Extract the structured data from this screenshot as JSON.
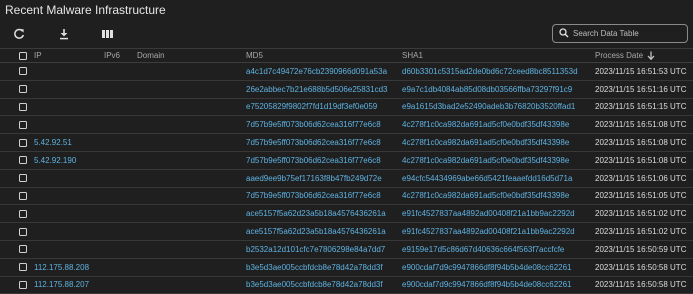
{
  "title": "Recent Malware Infrastructure",
  "toolbar": {
    "refresh_icon": "refresh-icon",
    "download_icon": "download-icon",
    "columns_icon": "columns-icon",
    "search_placeholder": "Search Data Table"
  },
  "columns": [
    "IP",
    "IPv6",
    "Domain",
    "MD5",
    "SHA1",
    "Process Date"
  ],
  "sort": {
    "column": "Process Date",
    "direction": "descending",
    "icon": "arrow-down-icon"
  },
  "colors": {
    "background": "#1f1f1f",
    "link": "#5fb3e3",
    "text": "#d6d6d6"
  },
  "rows": [
    {
      "ip": "",
      "ipv6": "",
      "domain": "",
      "md5": "a4c1d7c49472e76cb2390966d091a53a",
      "sha1": "d60b3301c5315ad2de0bd6c72ceed8bc8511353d",
      "date": "2023/11/15 16:51:53 UTC"
    },
    {
      "ip": "",
      "ipv6": "",
      "domain": "",
      "md5": "26e2abbec7b21e688b5d506e25831cd3",
      "sha1": "e9a7c1db4084ab85d08db03566ffba73297f91c9",
      "date": "2023/11/15 16:51:16 UTC"
    },
    {
      "ip": "",
      "ipv6": "",
      "domain": "",
      "md5": "e75205829f9802f7fd1d19df3ef0e059",
      "sha1": "e9a1615d3bad2e52490adeb3b76820b3520ffad1",
      "date": "2023/11/15 16:51:15 UTC"
    },
    {
      "ip": "",
      "ipv6": "",
      "domain": "",
      "md5": "7d57b9e5ff073b06d62cea316f77e6c8",
      "sha1": "4c278f1c0ca982da691ad5cf0e0bdf35df43398e",
      "date": "2023/11/15 16:51:08 UTC"
    },
    {
      "ip": "5.42.92.51",
      "ipv6": "",
      "domain": "",
      "md5": "7d57b9e5ff073b06d62cea316f77e6c8",
      "sha1": "4c278f1c0ca982da691ad5cf0e0bdf35df43398e",
      "date": "2023/11/15 16:51:08 UTC"
    },
    {
      "ip": "5.42.92.190",
      "ipv6": "",
      "domain": "",
      "md5": "7d57b9e5ff073b06d62cea316f77e6c8",
      "sha1": "4c278f1c0ca982da691ad5cf0e0bdf35df43398e",
      "date": "2023/11/15 16:51:08 UTC"
    },
    {
      "ip": "",
      "ipv6": "",
      "domain": "",
      "md5": "aaed9ee9b75ef17163f8b47fb249d72e",
      "sha1": "e94cfc54434969abe66d5421feaaefdd16d5d71a",
      "date": "2023/11/15 16:51:06 UTC"
    },
    {
      "ip": "",
      "ipv6": "",
      "domain": "",
      "md5": "7d57b9e5ff073b06d62cea316f77e6c8",
      "sha1": "4c278f1c0ca982da691ad5cf0e0bdf35df43398e",
      "date": "2023/11/15 16:51:05 UTC"
    },
    {
      "ip": "",
      "ipv6": "",
      "domain": "",
      "md5": "ace5157f5a62d23a5b18a4576436261a",
      "sha1": "e91fc4527837aa4892ad00408f21a1bb9ac2292d",
      "date": "2023/11/15 16:51:02 UTC"
    },
    {
      "ip": "",
      "ipv6": "",
      "domain": "",
      "md5": "ace5157f5a62d23a5b18a4576436261a",
      "sha1": "e91fc4527837aa4892ad00408f21a1bb9ac2292d",
      "date": "2023/11/15 16:51:02 UTC"
    },
    {
      "ip": "",
      "ipv6": "",
      "domain": "",
      "md5": "b2532a12d101cfc7e7806298e84a7dd7",
      "sha1": "e9159e17d5c86d67d40636c664f563f7accfcfe",
      "date": "2023/11/15 16:50:59 UTC"
    },
    {
      "ip": "112.175.88.208",
      "ipv6": "",
      "domain": "",
      "md5": "b3e5d3ae005ccbfdcb8e78d42a78dd3f",
      "sha1": "e900cdaf7d9c9947866df8f94b5b4de08cc62261",
      "date": "2023/11/15 16:50:58 UTC"
    },
    {
      "ip": "112.175.88.207",
      "ipv6": "",
      "domain": "",
      "md5": "b3e5d3ae005ccbfdcb8e78d42a78dd3f",
      "sha1": "e900cdaf7d9c9947866df8f94b5b4de08cc62261",
      "date": "2023/11/15 16:50:58 UTC"
    }
  ]
}
